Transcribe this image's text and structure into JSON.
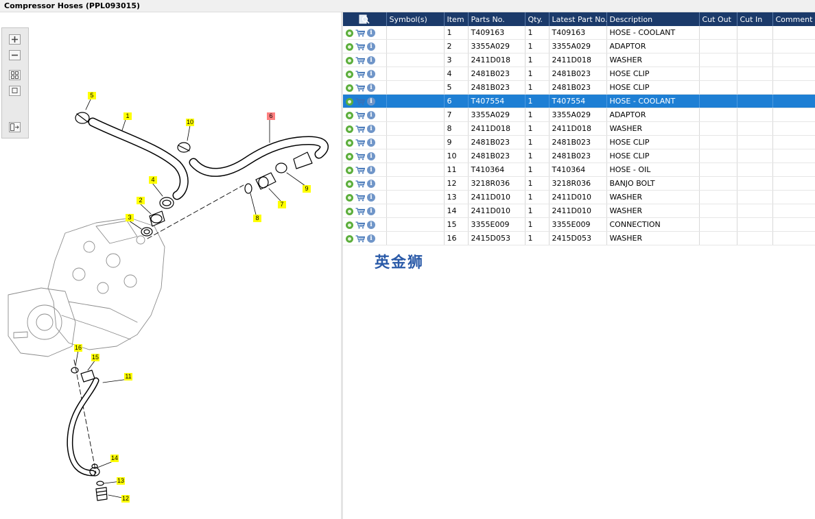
{
  "window": {
    "title": "Compressor Hoses (PPL093015)"
  },
  "diagram": {
    "callouts": [
      {
        "label": "5",
        "selected": false
      },
      {
        "label": "1",
        "selected": false
      },
      {
        "label": "6",
        "selected": true
      },
      {
        "label": "10",
        "selected": false
      },
      {
        "label": "4",
        "selected": false
      },
      {
        "label": "2",
        "selected": false
      },
      {
        "label": "3",
        "selected": false
      },
      {
        "label": "7",
        "selected": false
      },
      {
        "label": "8",
        "selected": false
      },
      {
        "label": "9",
        "selected": false
      },
      {
        "label": "16",
        "selected": false
      },
      {
        "label": "15",
        "selected": false
      },
      {
        "label": "11",
        "selected": false
      },
      {
        "label": "14",
        "selected": false
      },
      {
        "label": "13",
        "selected": false
      },
      {
        "label": "12",
        "selected": false
      }
    ]
  },
  "grid": {
    "columns": [
      "",
      "Symbol(s)",
      "Item",
      "Parts No.",
      "Qty.",
      "Latest Part No.",
      "Description",
      "Cut Out",
      "Cut In",
      "Comment"
    ],
    "selected_item": "6",
    "rows": [
      {
        "item": "1",
        "parts_no": "T409163",
        "qty": "1",
        "latest": "T409163",
        "desc": "HOSE - COOLANT"
      },
      {
        "item": "2",
        "parts_no": "3355A029",
        "qty": "1",
        "latest": "3355A029",
        "desc": "ADAPTOR"
      },
      {
        "item": "3",
        "parts_no": "2411D018",
        "qty": "1",
        "latest": "2411D018",
        "desc": "WASHER"
      },
      {
        "item": "4",
        "parts_no": "2481B023",
        "qty": "1",
        "latest": "2481B023",
        "desc": "HOSE CLIP"
      },
      {
        "item": "5",
        "parts_no": "2481B023",
        "qty": "1",
        "latest": "2481B023",
        "desc": "HOSE CLIP"
      },
      {
        "item": "6",
        "parts_no": "T407554",
        "qty": "1",
        "latest": "T407554",
        "desc": "HOSE - COOLANT"
      },
      {
        "item": "7",
        "parts_no": "3355A029",
        "qty": "1",
        "latest": "3355A029",
        "desc": "ADAPTOR"
      },
      {
        "item": "8",
        "parts_no": "2411D018",
        "qty": "1",
        "latest": "2411D018",
        "desc": "WASHER"
      },
      {
        "item": "9",
        "parts_no": "2481B023",
        "qty": "1",
        "latest": "2481B023",
        "desc": "HOSE CLIP"
      },
      {
        "item": "10",
        "parts_no": "2481B023",
        "qty": "1",
        "latest": "2481B023",
        "desc": "HOSE CLIP"
      },
      {
        "item": "11",
        "parts_no": "T410364",
        "qty": "1",
        "latest": "T410364",
        "desc": "HOSE - OIL"
      },
      {
        "item": "12",
        "parts_no": "3218R036",
        "qty": "1",
        "latest": "3218R036",
        "desc": "BANJO BOLT"
      },
      {
        "item": "13",
        "parts_no": "2411D010",
        "qty": "1",
        "latest": "2411D010",
        "desc": "WASHER"
      },
      {
        "item": "14",
        "parts_no": "2411D010",
        "qty": "1",
        "latest": "2411D010",
        "desc": "WASHER"
      },
      {
        "item": "15",
        "parts_no": "3355E009",
        "qty": "1",
        "latest": "3355E009",
        "desc": "CONNECTION"
      },
      {
        "item": "16",
        "parts_no": "2415D053",
        "qty": "1",
        "latest": "2415D053",
        "desc": "WASHER"
      }
    ]
  },
  "watermark": "英金狮",
  "icons": {
    "header": "search-document-icon",
    "row": [
      "gear-icon",
      "cart-icon",
      "info-icon"
    ],
    "toolbar": [
      "zoom-in-icon",
      "zoom-out-icon",
      "fit-all-icon",
      "actual-size-icon",
      "toggle-list-icon"
    ]
  },
  "colors": {
    "header_bg": "#1b3a6a",
    "selected_row": "#1e7fd4",
    "callout": "#ffff00",
    "callout_selected": "#ff7f7f"
  }
}
